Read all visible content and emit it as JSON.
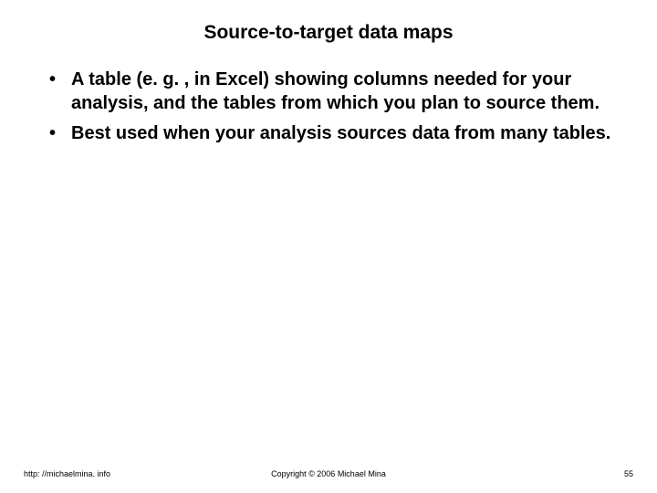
{
  "slide": {
    "title": "Source-to-target data maps",
    "bullets": [
      "A table (e. g. , in Excel) showing columns needed for your analysis, and the tables from which you plan to source them.",
      "Best used when your analysis sources data from many tables."
    ]
  },
  "footer": {
    "left": "http: //michaelmina. info",
    "center": "Copyright © 2006 Michael Mina",
    "right": "55"
  }
}
